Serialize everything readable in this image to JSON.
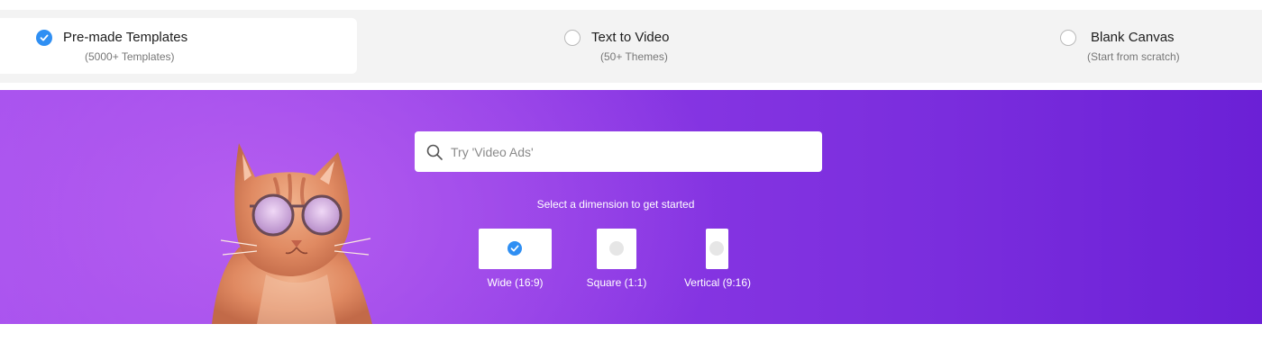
{
  "options": [
    {
      "title": "Pre-made Templates",
      "subtitle": "(5000+ Templates)",
      "selected": true
    },
    {
      "title": "Text to Video",
      "subtitle": "(50+ Themes)",
      "selected": false
    },
    {
      "title": "Blank Canvas",
      "subtitle": "(Start from scratch)",
      "selected": false
    }
  ],
  "hero": {
    "search": {
      "placeholder": "Try 'Video Ads'",
      "value": ""
    },
    "dimension_prompt": "Select a dimension to get started",
    "dimensions": [
      {
        "label": "Wide (16:9)",
        "selected": true
      },
      {
        "label": "Square (1:1)",
        "selected": false
      },
      {
        "label": "Vertical (9:16)",
        "selected": false
      }
    ]
  },
  "colors": {
    "accent": "#2f8ff3",
    "hero_start": "#a44fee",
    "hero_end": "#6b20d6",
    "tab_bar": "#f3f3f3"
  },
  "icons": {
    "check": "check-icon",
    "search": "search-icon"
  }
}
